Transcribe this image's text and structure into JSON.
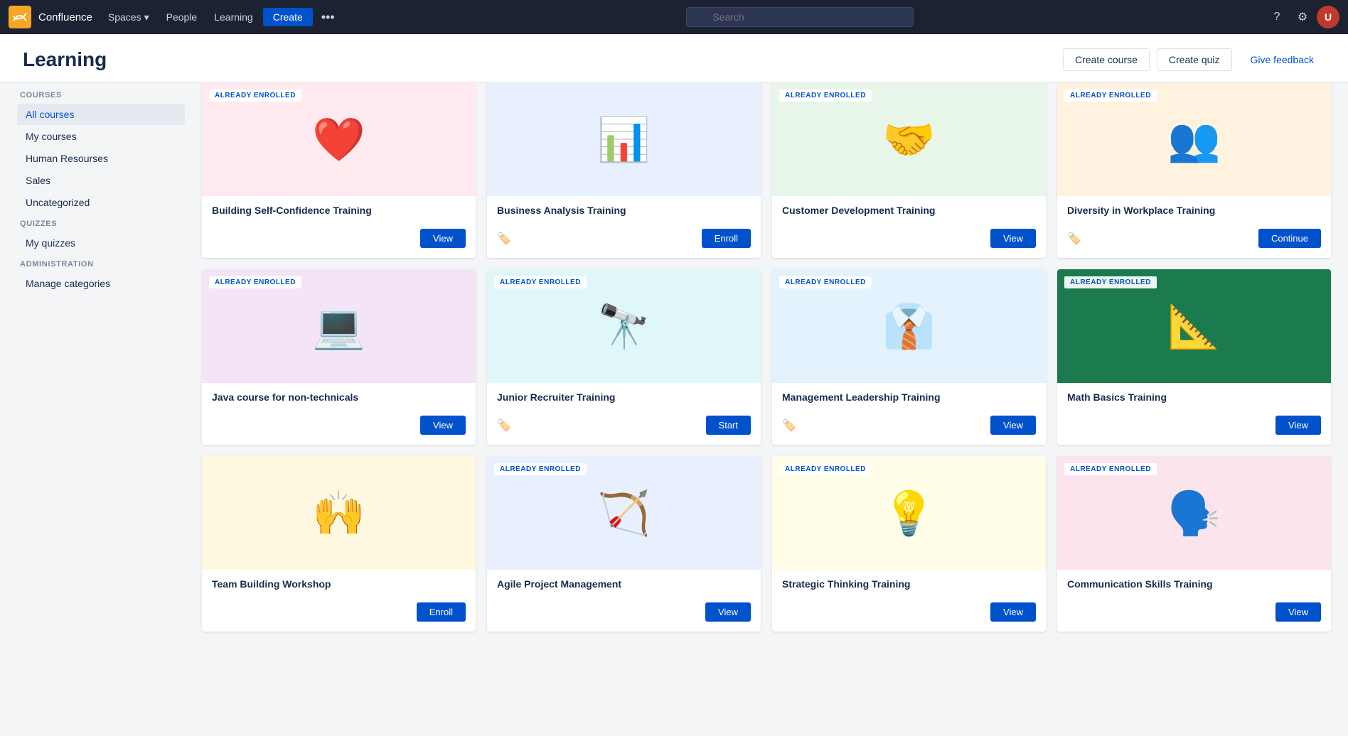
{
  "topnav": {
    "brand": "Confluence",
    "spaces_label": "Spaces",
    "people_label": "People",
    "learning_label": "Learning",
    "create_label": "Create",
    "search_placeholder": "Search"
  },
  "page_header": {
    "title": "Learning",
    "create_course_label": "Create course",
    "create_quiz_label": "Create quiz",
    "give_feedback_label": "Give feedback"
  },
  "sidebar": {
    "courses_section": "COURSES",
    "items_courses": [
      {
        "label": "All courses",
        "active": true
      },
      {
        "label": "My courses",
        "active": false
      },
      {
        "label": "Human Resourses",
        "active": false
      },
      {
        "label": "Sales",
        "active": false
      },
      {
        "label": "Uncategorized",
        "active": false
      }
    ],
    "quizzes_section": "QUIZZES",
    "items_quizzes": [
      {
        "label": "My quizzes",
        "active": false
      }
    ],
    "admin_section": "ADMINISTRATION",
    "items_admin": [
      {
        "label": "Manage categories",
        "active": false
      }
    ]
  },
  "courses": [
    {
      "id": 1,
      "title": "Building Self-Confidence Training",
      "enrolled": true,
      "badge": "ALREADY ENROLLED",
      "button_label": "View",
      "bg": "bg-pink",
      "emoji": "❤️",
      "has_tag": false
    },
    {
      "id": 2,
      "title": "Business Analysis Training",
      "enrolled": false,
      "badge": "",
      "button_label": "Enroll",
      "bg": "bg-blue",
      "emoji": "📊",
      "has_tag": true
    },
    {
      "id": 3,
      "title": "Customer Development Training",
      "enrolled": true,
      "badge": "ALREADY ENROLLED",
      "button_label": "View",
      "bg": "bg-green",
      "emoji": "🤝",
      "has_tag": false
    },
    {
      "id": 4,
      "title": "Diversity in Workplace Training",
      "enrolled": true,
      "badge": "ALREADY ENROLLED",
      "button_label": "Continue",
      "bg": "bg-orange",
      "emoji": "👥",
      "has_tag": true
    },
    {
      "id": 5,
      "title": "Java course for non-technicals",
      "enrolled": true,
      "badge": "ALREADY ENROLLED",
      "button_label": "View",
      "bg": "bg-purple",
      "emoji": "💻",
      "has_tag": false
    },
    {
      "id": 6,
      "title": "Junior Recruiter Training",
      "enrolled": true,
      "badge": "ALREADY ENROLLED",
      "button_label": "Start",
      "bg": "bg-teal",
      "emoji": "🔭",
      "has_tag": true
    },
    {
      "id": 7,
      "title": "Management Leadership Training",
      "enrolled": true,
      "badge": "ALREADY ENROLLED",
      "button_label": "View",
      "bg": "bg-lightblue",
      "emoji": "👔",
      "has_tag": true
    },
    {
      "id": 8,
      "title": "Math Basics Training",
      "enrolled": true,
      "badge": "ALREADY ENROLLED",
      "button_label": "View",
      "bg": "bg-darkgreen",
      "emoji": "📐",
      "has_tag": false
    },
    {
      "id": 9,
      "title": "Team Building Workshop",
      "enrolled": false,
      "badge": "",
      "button_label": "Enroll",
      "bg": "bg-warm",
      "emoji": "🙌",
      "has_tag": false
    },
    {
      "id": 10,
      "title": "Agile Project Management",
      "enrolled": true,
      "badge": "ALREADY ENROLLED",
      "button_label": "View",
      "bg": "bg-blue",
      "emoji": "🏹",
      "has_tag": false
    },
    {
      "id": 11,
      "title": "Strategic Thinking Training",
      "enrolled": true,
      "badge": "ALREADY ENROLLED",
      "button_label": "View",
      "bg": "bg-yellow",
      "emoji": "💡",
      "has_tag": false
    },
    {
      "id": 12,
      "title": "Communication Skills Training",
      "enrolled": true,
      "badge": "ALREADY ENROLLED",
      "button_label": "View",
      "bg": "bg-coral",
      "emoji": "🗣️",
      "has_tag": false
    }
  ]
}
